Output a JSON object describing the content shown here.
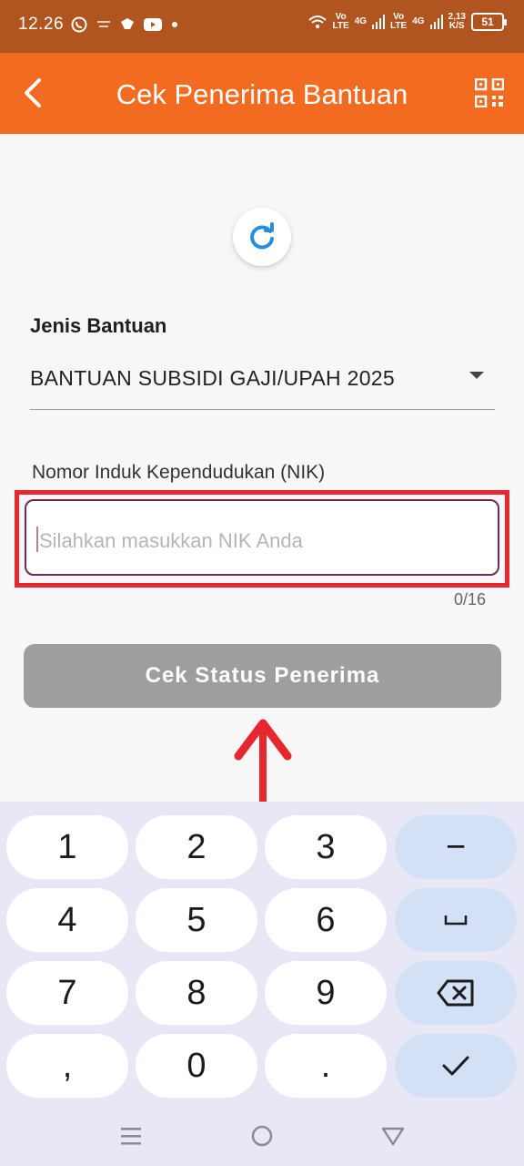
{
  "status_bar": {
    "time": "12.26",
    "net_left_1": "Vo",
    "net_left_2": "LTE",
    "net_left_3": "4G",
    "net_right_1": "Vo",
    "net_right_2": "LTE",
    "net_right_3": "4G",
    "speed_value": "2,13",
    "speed_unit": "K/S",
    "battery": "51"
  },
  "app_bar": {
    "title": "Cek Penerima Bantuan"
  },
  "form": {
    "jenis_label": "Jenis Bantuan",
    "jenis_value": "BANTUAN SUBSIDI GAJI/UPAH 2025",
    "nik_label": "Nomor Induk Kependudukan (NIK)",
    "nik_value": "",
    "nik_placeholder": "Silahkan masukkan NIK Anda",
    "nik_counter": "0/16",
    "submit_label": "Cek Status Penerima"
  },
  "keyboard": {
    "k1": "1",
    "k2": "2",
    "k3": "3",
    "k_minus": "−",
    "k4": "4",
    "k5": "5",
    "k6": "6",
    "k_space": "␣",
    "k7": "7",
    "k8": "8",
    "k9": "9",
    "k_backspace": "backspace-icon",
    "k_comma": ",",
    "k0": "0",
    "k_dot": ".",
    "k_enter": "check-icon"
  },
  "colors": {
    "status_bar": "#b0551f",
    "app_bar": "#f26b21",
    "highlight": "#e8262f",
    "button_disabled": "#9e9e9e",
    "input_border": "#6e2a58",
    "keyboard_bg": "#e8e7f6"
  }
}
